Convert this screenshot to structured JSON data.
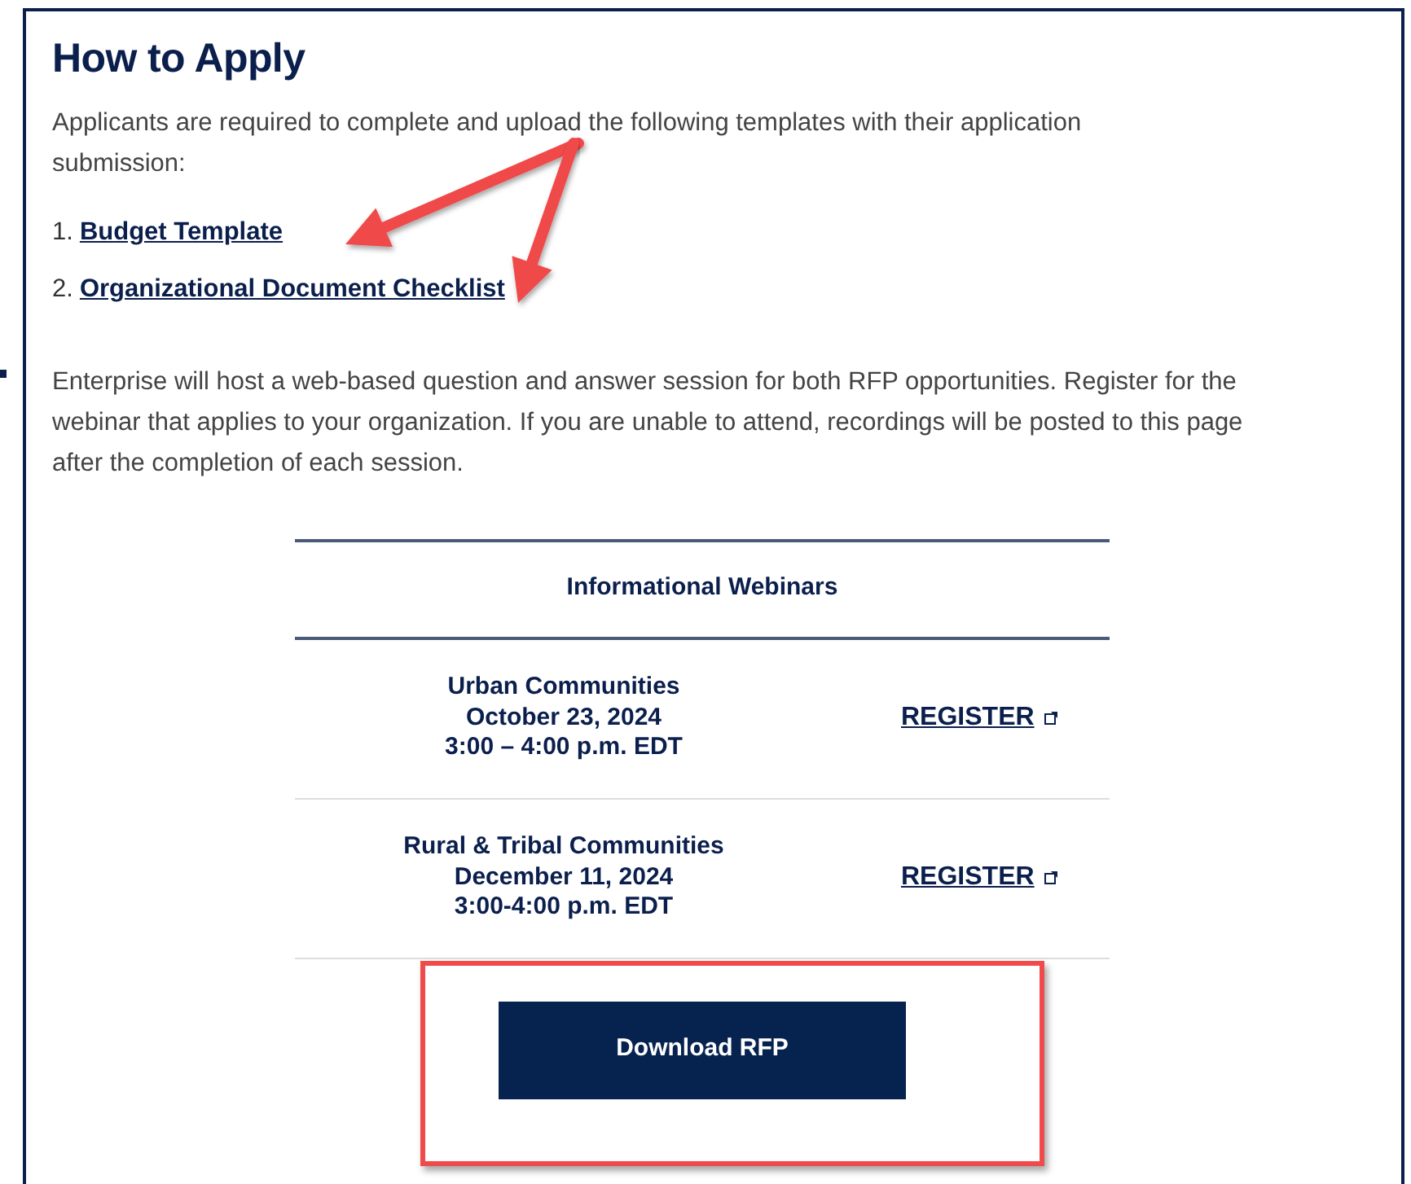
{
  "section": {
    "title": "How to Apply",
    "intro": "Applicants are required to complete and upload the following templates with their application submission:",
    "templates": [
      {
        "number": "1.",
        "label": "Budget Template"
      },
      {
        "number": "2.",
        "label": "Organizational Document Checklist"
      }
    ],
    "webinar_note": "Enterprise will host a web-based question and answer session for both RFP opportunities. Register for the webinar that applies to your organization. If you are unable to attend, recordings will be posted to this page after the completion of each session."
  },
  "table": {
    "heading": "Informational Webinars",
    "rows": [
      {
        "lines": [
          "Urban Communities",
          "October 23, 2024",
          "3:00 – 4:00 p.m. EDT"
        ],
        "link": "REGISTER"
      },
      {
        "lines": [
          "Rural & Tribal Communities",
          "December 11, 2024",
          "3:00-4:00 p.m. EDT"
        ],
        "link": "REGISTER"
      }
    ]
  },
  "download_button": "Download RFP",
  "annotations": [
    {
      "kind": "arrow"
    },
    {
      "kind": "arrow"
    },
    {
      "kind": "highlight"
    }
  ]
}
